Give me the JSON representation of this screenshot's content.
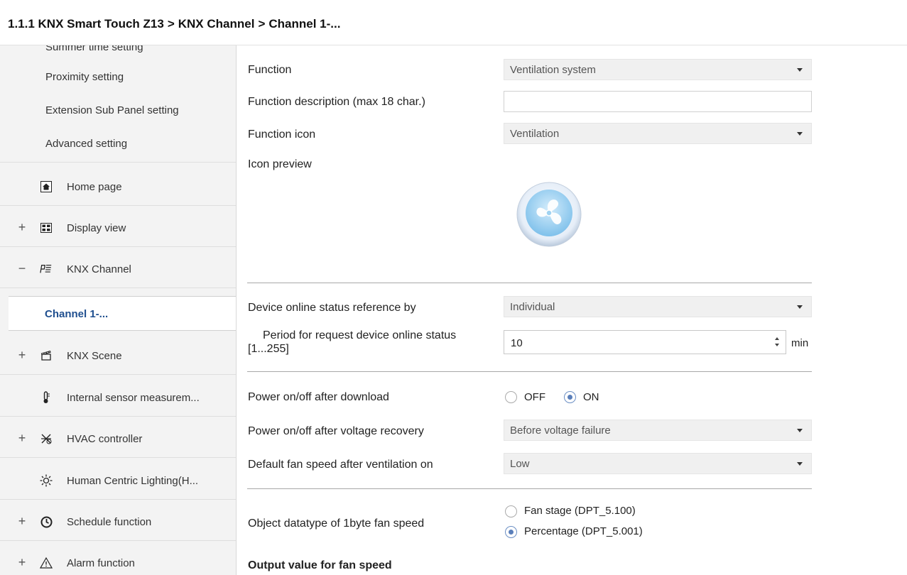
{
  "breadcrumb": {
    "items": [
      "1.1.1 KNX Smart Touch Z13",
      "KNX Channel",
      "Channel 1-..."
    ],
    "separator": ">"
  },
  "sidebar": {
    "cut_item": "Summer time setting",
    "sub_items": [
      "Proximity setting",
      "Extension Sub Panel setting",
      "Advanced setting"
    ],
    "items": [
      {
        "expander": "",
        "icon": "home-icon",
        "label": "Home page"
      },
      {
        "expander": "+",
        "icon": "display-grid-icon",
        "label": "Display view"
      },
      {
        "expander": "−",
        "icon": "knx-channel-icon",
        "label": "KNX Channel"
      },
      {
        "expander": "+",
        "icon": "clapperboard-icon",
        "label": "KNX Scene"
      },
      {
        "expander": "",
        "icon": "thermometer-icon",
        "label": "Internal sensor measurem..."
      },
      {
        "expander": "+",
        "icon": "hvac-icon",
        "label": "HVAC controller"
      },
      {
        "expander": "",
        "icon": "sun-icon",
        "label": "Human Centric Lighting(H..."
      },
      {
        "expander": "+",
        "icon": "clock-icon",
        "label": "Schedule function"
      },
      {
        "expander": "+",
        "icon": "warning-icon",
        "label": "Alarm function"
      }
    ],
    "selected": "Channel 1-..."
  },
  "form": {
    "function": {
      "label": "Function",
      "value": "Ventilation system"
    },
    "description": {
      "label": "Function description (max 18 char.)",
      "value": ""
    },
    "icon": {
      "label": "Function icon",
      "value": "Ventilation"
    },
    "preview": {
      "label": "Icon preview"
    },
    "online_ref": {
      "label": "Device online status reference by",
      "value": "Individual"
    },
    "period": {
      "label_line1": "Period for request device online status",
      "label_line2": "[1...255]",
      "value": "10",
      "unit": "min"
    },
    "power_download": {
      "label": "Power on/off after download",
      "options": [
        "OFF",
        "ON"
      ],
      "selected": "ON"
    },
    "power_recovery": {
      "label": "Power on/off after voltage recovery",
      "value": "Before voltage failure"
    },
    "default_speed": {
      "label": "Default fan speed after ventilation on",
      "value": "Low"
    },
    "datatype": {
      "label": "Object datatype of 1byte fan speed",
      "options": [
        "Fan stage (DPT_5.100)",
        "Percentage (DPT_5.001)"
      ],
      "selected": "Percentage (DPT_5.001)"
    },
    "output_heading": "Output value for fan speed"
  },
  "colors": {
    "accent": "#1f4f8f",
    "radio": "#5a7fba",
    "sidebar_bg": "#f3f3f3"
  }
}
